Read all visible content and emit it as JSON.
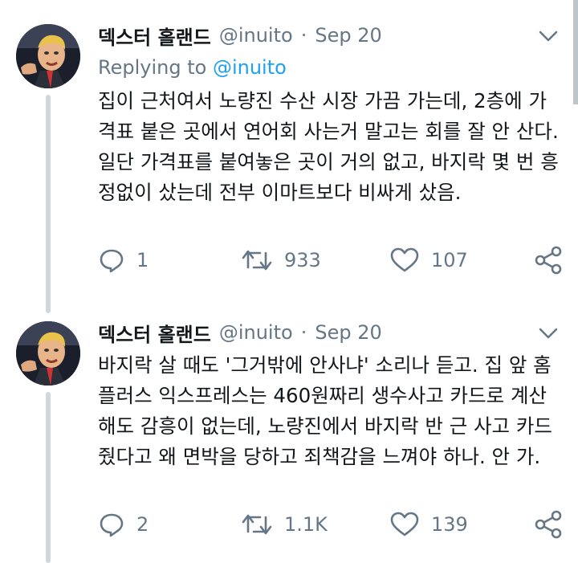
{
  "tweets": [
    {
      "author_name": "덱스터 홀랜드",
      "author_handle": "@inuito",
      "separator": "·",
      "timestamp": "Sep 20",
      "replying_prefix": "Replying to",
      "replying_to": "@inuito",
      "body": "집이 근처여서 노량진 수산 시장 가끔 가는데, 2층에 가격표 붙은 곳에서 연어회 사는거 말고는 회를 잘 안 산다. 일단 가격표를 붙여놓은 곳이 거의 없고, 바지락 몇 번 흥정없이 샀는데 전부 이마트보다 비싸게 샀음.",
      "replies": "1",
      "retweets": "933",
      "likes": "107"
    },
    {
      "author_name": "덱스터 홀랜드",
      "author_handle": "@inuito",
      "separator": "·",
      "timestamp": "Sep 20",
      "body": "바지락 살 때도 '그거밖에 안사냐' 소리나 듣고. 집 앞 홈플러스 익스프레스는 460원짜리 생수사고 카드로 계산해도 감흥이 없는데, 노량진에서 바지락 반 근 사고 카드 줬다고 왜 면박을 당하고 죄책감을 느껴야 하나. 안 가.",
      "replies": "2",
      "retweets": "1.1K",
      "likes": "139"
    }
  ],
  "colors": {
    "text": "#14171a",
    "secondary": "#657786",
    "link": "#1da1f2",
    "thread_line": "#d0d7dd"
  },
  "icons": [
    "chevron-down-icon",
    "reply-icon",
    "retweet-icon",
    "like-icon",
    "share-icon"
  ]
}
